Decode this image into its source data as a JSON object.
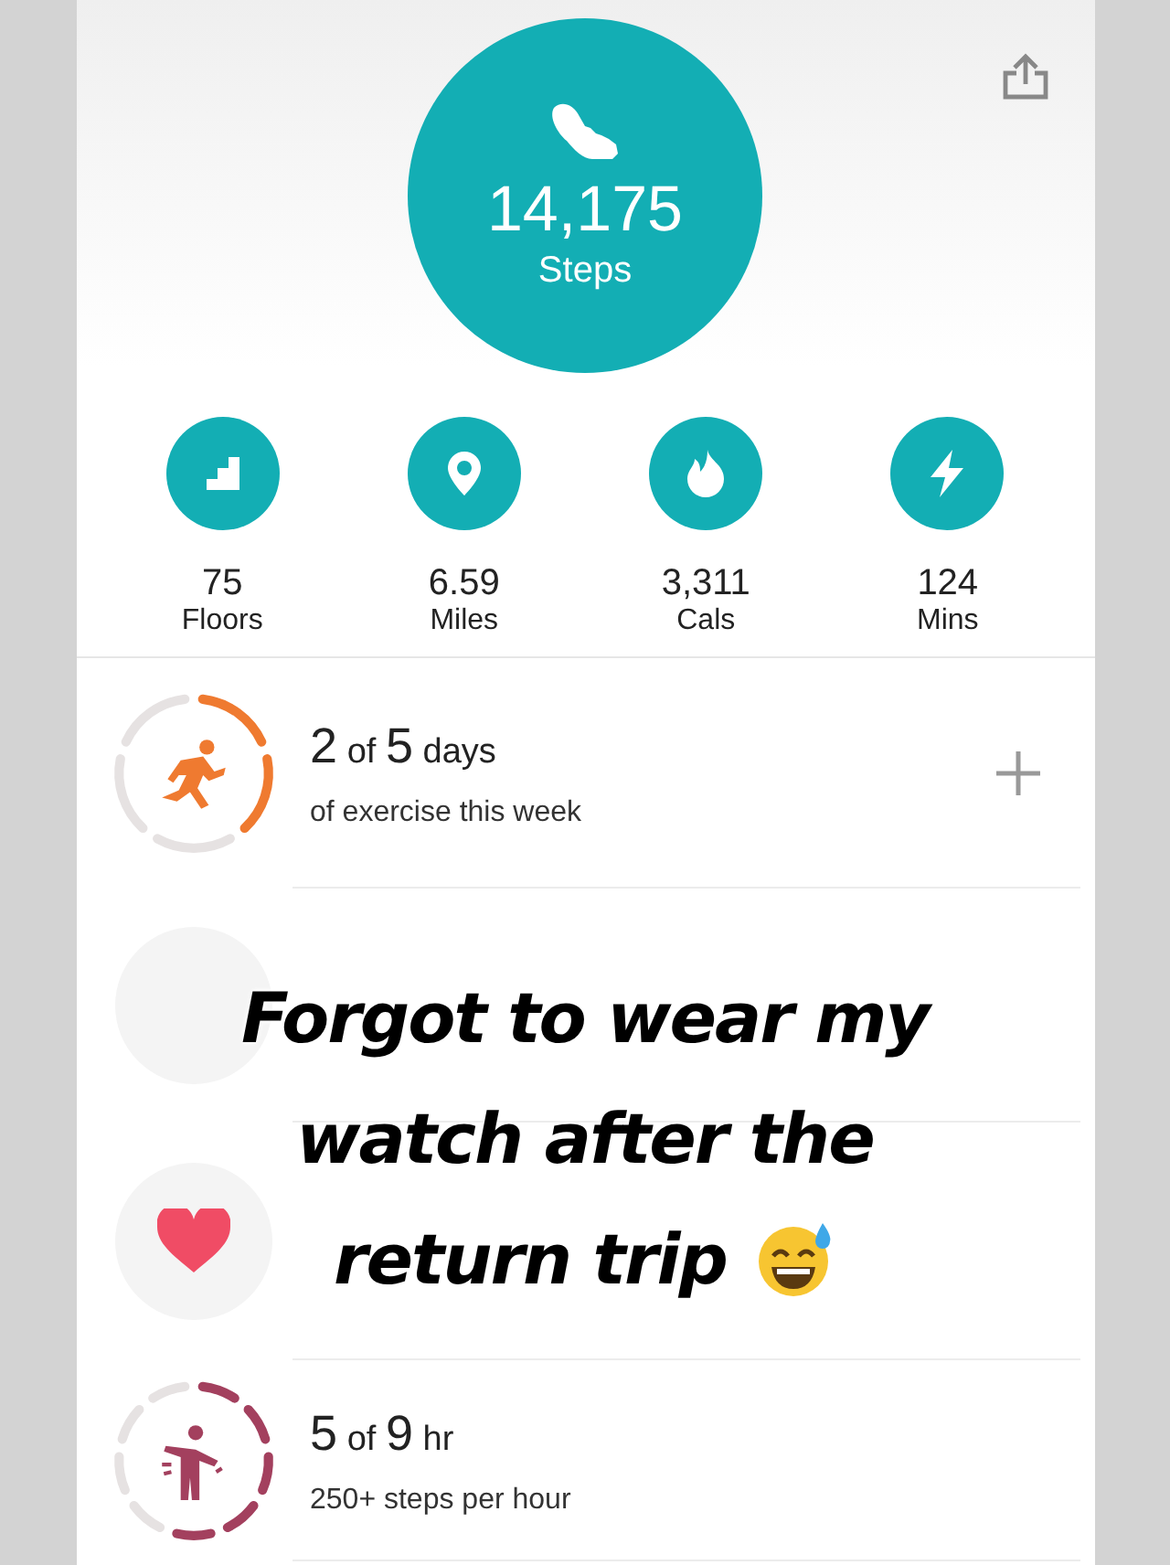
{
  "steps": {
    "value": "14,175",
    "label": "Steps"
  },
  "stats": [
    {
      "kind": "floors",
      "value": "75",
      "label": "Floors"
    },
    {
      "kind": "distance",
      "value": "6.59",
      "label": "Miles"
    },
    {
      "kind": "calories",
      "value": "3,311",
      "label": "Cals"
    },
    {
      "kind": "minutes",
      "value": "124",
      "label": "Mins"
    }
  ],
  "goals": [
    {
      "kind": "exercise",
      "amount": "2",
      "joiner": "of",
      "goal": "5",
      "unit": "days",
      "caption": "of exercise this week",
      "level": 0.4
    },
    {
      "kind": "hidden"
    },
    {
      "kind": "heart"
    },
    {
      "kind": "hourly",
      "amount": "5",
      "joiner": "of",
      "goal": "9",
      "unit": "hr",
      "caption": "250+ steps per hour",
      "level": 0.556
    }
  ],
  "overlay": {
    "lines": [
      "Forgot to wear my",
      "watch after the",
      "return trip"
    ]
  }
}
